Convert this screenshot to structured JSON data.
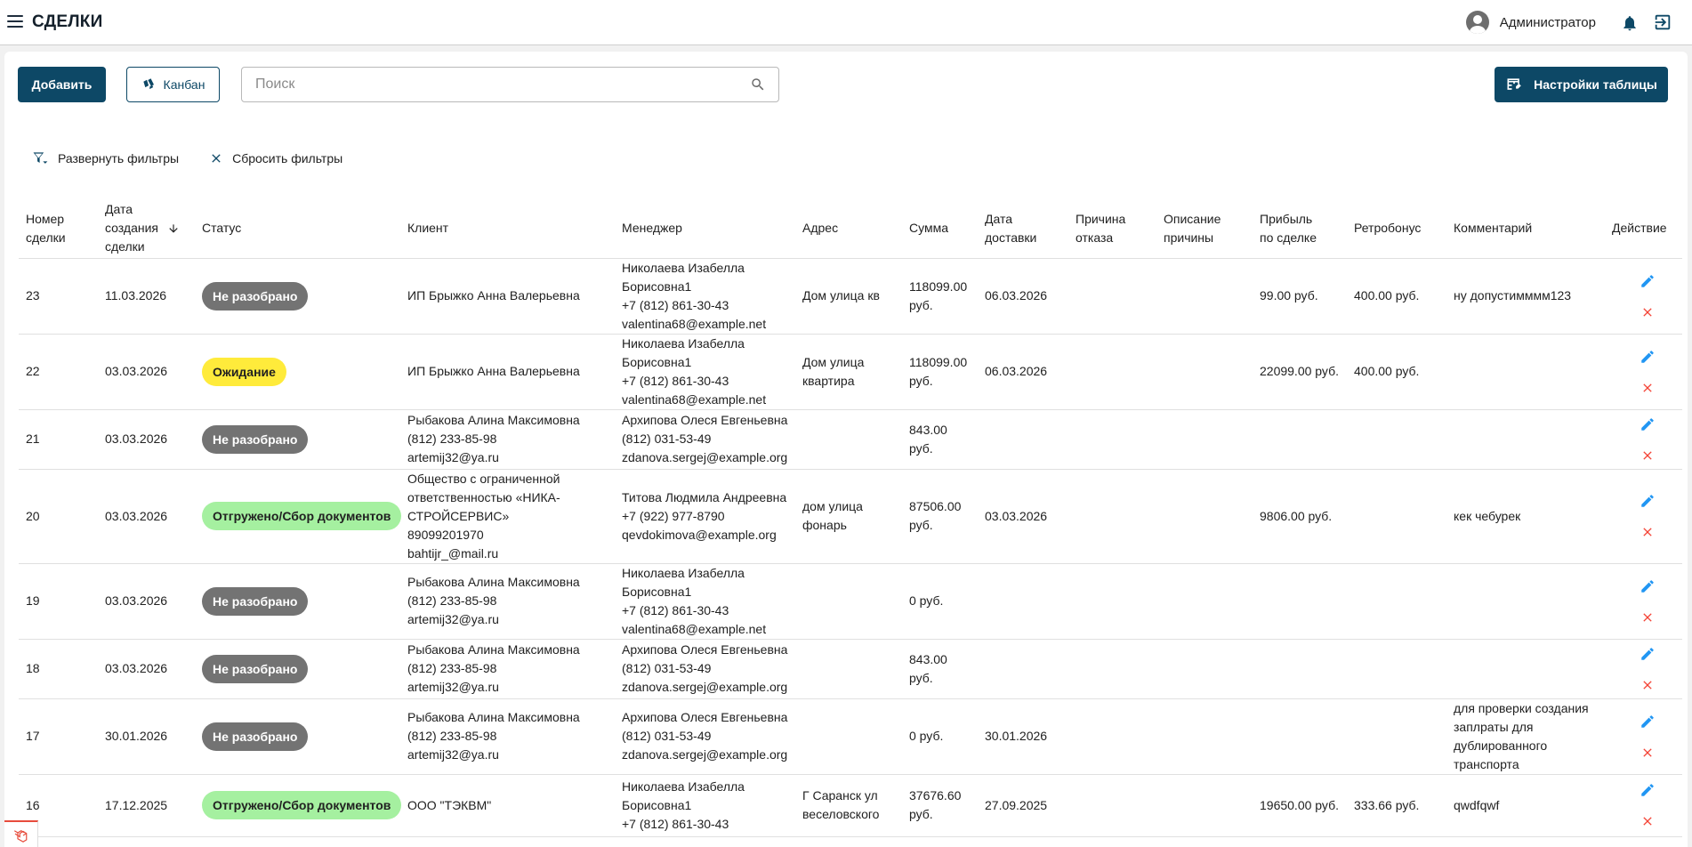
{
  "header": {
    "title": "СДЕЛКИ",
    "user_name": "Администратор"
  },
  "toolbar": {
    "add_label": "Добавить",
    "kanban_label": "Канбан",
    "search_placeholder": "Поиск",
    "settings_label": "Настройки таблицы"
  },
  "filters": {
    "expand_label": "Развернуть фильтры",
    "reset_label": "Сбросить фильтры"
  },
  "table": {
    "columns": {
      "number": [
        "Номер",
        "сделки"
      ],
      "created": [
        "Дата",
        "создания",
        "сделки"
      ],
      "status": "Статус",
      "client": "Клиент",
      "manager": "Менеджер",
      "address": "Адрес",
      "sum": "Сумма",
      "delivery": [
        "Дата",
        "доставки"
      ],
      "reason": [
        "Причина",
        "отказа"
      ],
      "reason_desc": [
        "Описание",
        "причины"
      ],
      "profit": [
        "Прибыль",
        "по сделке"
      ],
      "retrobonus": "Ретробонус",
      "comment": "Комментарий",
      "action": "Действие"
    },
    "rows": [
      {
        "number": "23",
        "created": "11.03.2026",
        "status": "Не разобрано",
        "status_color": "#737373",
        "status_text_color": "#ffffff",
        "client": [
          "ИП Брыжко Анна Валерьевна"
        ],
        "manager": [
          "Николаева Изабелла",
          "Борисовна1",
          "+7 (812) 861-30-43",
          "valentina68@example.net"
        ],
        "address": [
          "Дом улица кв"
        ],
        "sum": [
          "118099.00",
          "руб."
        ],
        "delivery": "06.03.2026",
        "reason": "",
        "reason_desc": "",
        "profit": "99.00 руб.",
        "retrobonus": "400.00 руб.",
        "comment": [
          "ну допустимммм123"
        ]
      },
      {
        "number": "22",
        "created": "03.03.2026",
        "status": "Ожидание",
        "status_color": "#ffeb3b",
        "status_text_color": "#212121",
        "client": [
          "ИП Брыжко Анна Валерьевна"
        ],
        "manager": [
          "Николаева Изабелла",
          "Борисовна1",
          "+7 (812) 861-30-43",
          "valentina68@example.net"
        ],
        "address": [
          "Дом улица",
          "квартира"
        ],
        "sum": [
          "118099.00",
          "руб."
        ],
        "delivery": "06.03.2026",
        "reason": "",
        "reason_desc": "",
        "profit": "22099.00 руб.",
        "retrobonus": "400.00 руб.",
        "comment": []
      },
      {
        "number": "21",
        "created": "03.03.2026",
        "status": "Не разобрано",
        "status_color": "#737373",
        "status_text_color": "#ffffff",
        "client": [
          "Рыбакова Алина Максимовна",
          "(812) 233-85-98",
          "artemij32@ya.ru"
        ],
        "manager": [
          "Архипова Олеся Евгеньевна",
          "(812) 031-53-49",
          "zdanova.sergej@example.org"
        ],
        "address": [],
        "sum": [
          "843.00",
          "руб."
        ],
        "delivery": "",
        "reason": "",
        "reason_desc": "",
        "profit": "",
        "retrobonus": "",
        "comment": []
      },
      {
        "number": "20",
        "created": "03.03.2026",
        "status": "Отгружено/Сбор документов",
        "status_color": "#a5f0a0",
        "status_text_color": "#212121",
        "client": [
          "Общество с ограниченной",
          "ответственностью «НИКА-",
          "СТРОЙСЕРВИС»",
          "89099201970",
          "bahtijr_@mail.ru"
        ],
        "manager": [
          "Титова Людмила Андреевна",
          "+7 (922) 977-8790",
          "qevdokimova@example.org"
        ],
        "address": [
          "дом улица",
          "фонарь"
        ],
        "sum": [
          "87506.00",
          "руб."
        ],
        "delivery": "03.03.2026",
        "reason": "",
        "reason_desc": "",
        "profit": "9806.00 руб.",
        "retrobonus": "",
        "comment": [
          "кек чебурек"
        ]
      },
      {
        "number": "19",
        "created": "03.03.2026",
        "status": "Не разобрано",
        "status_color": "#737373",
        "status_text_color": "#ffffff",
        "client": [
          "Рыбакова Алина Максимовна",
          "(812) 233-85-98",
          "artemij32@ya.ru"
        ],
        "manager": [
          "Николаева Изабелла",
          "Борисовна1",
          "+7 (812) 861-30-43",
          "valentina68@example.net"
        ],
        "address": [],
        "sum": [
          "0 руб."
        ],
        "delivery": "",
        "reason": "",
        "reason_desc": "",
        "profit": "",
        "retrobonus": "",
        "comment": []
      },
      {
        "number": "18",
        "created": "03.03.2026",
        "status": "Не разобрано",
        "status_color": "#737373",
        "status_text_color": "#ffffff",
        "client": [
          "Рыбакова Алина Максимовна",
          "(812) 233-85-98",
          "artemij32@ya.ru"
        ],
        "manager": [
          "Архипова Олеся Евгеньевна",
          "(812) 031-53-49",
          "zdanova.sergej@example.org"
        ],
        "address": [],
        "sum": [
          "843.00",
          "руб."
        ],
        "delivery": "",
        "reason": "",
        "reason_desc": "",
        "profit": "",
        "retrobonus": "",
        "comment": []
      },
      {
        "number": "17",
        "created": "30.01.2026",
        "status": "Не разобрано",
        "status_color": "#737373",
        "status_text_color": "#ffffff",
        "client": [
          "Рыбакова Алина Максимовна",
          "(812) 233-85-98",
          "artemij32@ya.ru"
        ],
        "manager": [
          "Архипова Олеся Евгеньевна",
          "(812) 031-53-49",
          "zdanova.sergej@example.org"
        ],
        "address": [],
        "sum": [
          "0 руб."
        ],
        "delivery": "30.01.2026",
        "reason": "",
        "reason_desc": "",
        "profit": "",
        "retrobonus": "",
        "comment": [
          "для проверки создания",
          "заплраты для",
          "дублированного",
          "транспорта"
        ]
      },
      {
        "number": "16",
        "created": "17.12.2025",
        "status": "Отгружено/Сбор документов",
        "status_color": "#a5f0a0",
        "status_text_color": "#212121",
        "client": [
          "ООО \"ТЭКВМ\""
        ],
        "manager": [
          "Николаева Изабелла",
          "Борисовна1",
          "+7 (812) 861-30-43"
        ],
        "address": [
          "Г Саранск ул",
          "веселовского"
        ],
        "sum": [
          "37676.60",
          "руб."
        ],
        "delivery": "27.09.2025",
        "reason": "",
        "reason_desc": "",
        "profit": "19650.00 руб.",
        "retrobonus": "333.66 руб.",
        "comment": [
          "qwdfqwf"
        ]
      }
    ]
  },
  "colors": {
    "primary": "#0d4866",
    "icon_edit": "#2196f3",
    "icon_delete": "#f44336"
  }
}
